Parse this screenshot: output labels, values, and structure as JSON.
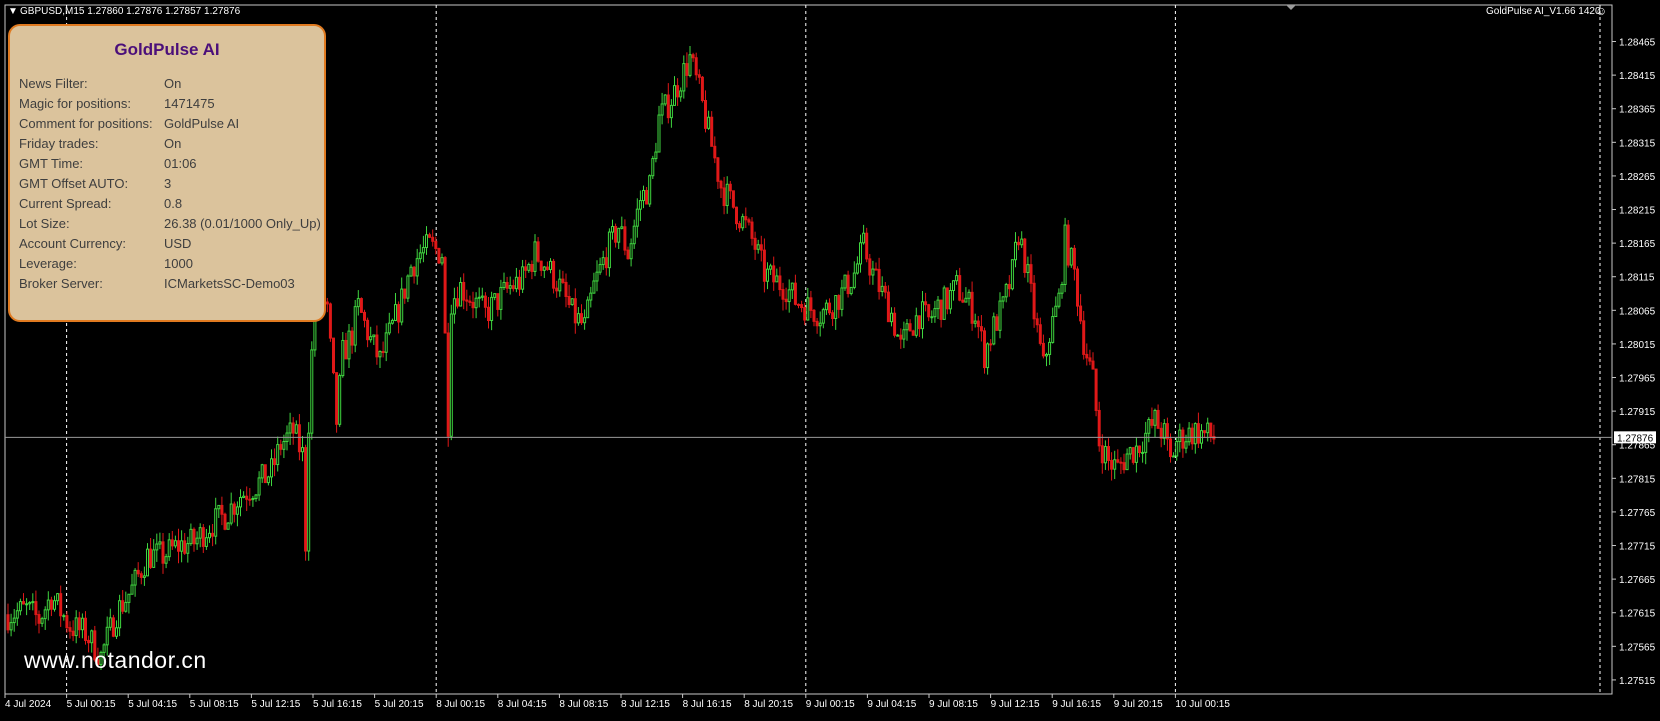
{
  "header": {
    "symbol_info": "GBPUSD,M15  1.27860 1.27876 1.27857 1.27876",
    "ea_label": "GoldPulse AI_V1.66 1420"
  },
  "panel": {
    "title": "GoldPulse AI",
    "rows": [
      {
        "label": "News Filter:",
        "value": "On"
      },
      {
        "label": "Magic for positions:",
        "value": "1471475"
      },
      {
        "label": "Comment for positions:",
        "value": "GoldPulse AI"
      },
      {
        "label": "Friday trades:",
        "value": "On"
      },
      {
        "label": "GMT Time:",
        "value": "01:06"
      },
      {
        "label": "GMT Offset AUTO:",
        "value": "3"
      },
      {
        "label": "Current Spread:",
        "value": "0.8"
      },
      {
        "label": "Lot Size:",
        "value": "26.38 (0.01/1000 Only_Up)"
      },
      {
        "label": "Account Currency:",
        "value": "USD"
      },
      {
        "label": "Leverage:",
        "value": "1000"
      },
      {
        "label": "Broker Server:",
        "value": "ICMarketsSC-Demo03"
      }
    ]
  },
  "watermark": "www.notandor.cn",
  "colors": {
    "background": "#000000",
    "bull": "#3fd63f",
    "bear": "#e01818",
    "grid": "#ffffff",
    "panel_bg": "#dbc39c",
    "panel_border": "#e07a20",
    "panel_title": "#4b0f7a"
  },
  "chart_data": {
    "type": "candlestick",
    "symbol": "GBPUSD",
    "timeframe": "M15",
    "current_price": "1.27876",
    "y_ticks": [
      "1.28465",
      "1.28415",
      "1.28365",
      "1.28315",
      "1.28265",
      "1.28215",
      "1.28165",
      "1.28115",
      "1.28065",
      "1.28015",
      "1.27965",
      "1.27915",
      "1.27865",
      "1.27815",
      "1.27765",
      "1.27715",
      "1.27665",
      "1.27615",
      "1.27565",
      "1.27515"
    ],
    "x_ticks": [
      "4 Jul 2024",
      "5 Jul 00:15",
      "5 Jul 04:15",
      "5 Jul 08:15",
      "5 Jul 12:15",
      "5 Jul 16:15",
      "5 Jul 20:15",
      "8 Jul 00:15",
      "8 Jul 04:15",
      "8 Jul 08:15",
      "8 Jul 12:15",
      "8 Jul 16:15",
      "8 Jul 20:15",
      "9 Jul 00:15",
      "9 Jul 04:15",
      "9 Jul 08:15",
      "9 Jul 12:15",
      "9 Jul 16:15",
      "9 Jul 20:15",
      "10 Jul 00:15"
    ],
    "day_separators": [
      "5 Jul 00:15",
      "8 Jul 00:15",
      "9 Jul 00:15",
      "10 Jul 00:15"
    ],
    "ylim": [
      1.275,
      1.285
    ],
    "close_path": [
      [
        0,
        1.27612
      ],
      [
        6,
        1.2762
      ],
      [
        10,
        1.27605
      ],
      [
        14,
        1.2764
      ],
      [
        20,
        1.27595
      ],
      [
        25,
        1.27585
      ],
      [
        30,
        1.2755
      ],
      [
        35,
        1.27615
      ],
      [
        40,
        1.2765
      ],
      [
        45,
        1.277
      ],
      [
        50,
        1.277
      ],
      [
        55,
        1.27715
      ],
      [
        60,
        1.2772
      ],
      [
        65,
        1.27745
      ],
      [
        70,
        1.2776
      ],
      [
        75,
        1.2779
      ],
      [
        80,
        1.27805
      ],
      [
        85,
        1.27825
      ],
      [
        88,
        1.27865
      ],
      [
        92,
        1.27885
      ],
      [
        95,
        1.2785
      ],
      [
        96,
        1.2772
      ],
      [
        97,
        1.279
      ],
      [
        98,
        1.28
      ],
      [
        99,
        1.2808
      ],
      [
        100,
        1.281
      ],
      [
        103,
        1.2806
      ],
      [
        106,
        1.279
      ],
      [
        108,
        1.28
      ],
      [
        111,
        1.2803
      ],
      [
        113,
        1.2807
      ],
      [
        117,
        1.2802
      ],
      [
        120,
        1.2799
      ],
      [
        124,
        1.2804
      ],
      [
        127,
        1.2808
      ],
      [
        130,
        1.2813
      ],
      [
        133,
        1.2815
      ],
      [
        136,
        1.2816
      ],
      [
        140,
        1.2815
      ],
      [
        142,
        1.279
      ],
      [
        143,
        1.2808
      ],
      [
        146,
        1.281
      ],
      [
        150,
        1.2808
      ],
      [
        154,
        1.2806
      ],
      [
        158,
        1.2808
      ],
      [
        162,
        1.281
      ],
      [
        166,
        1.2811
      ],
      [
        170,
        1.2815
      ],
      [
        174,
        1.2813
      ],
      [
        178,
        1.281
      ],
      [
        182,
        1.2806
      ],
      [
        186,
        1.2804
      ],
      [
        189,
        1.281
      ],
      [
        193,
        1.2815
      ],
      [
        197,
        1.2819
      ],
      [
        200,
        1.2815
      ],
      [
        204,
        1.2823
      ],
      [
        207,
        1.2825
      ],
      [
        210,
        1.2835
      ],
      [
        214,
        1.2838
      ],
      [
        218,
        1.2842
      ],
      [
        220,
        1.2844
      ],
      [
        223,
        1.2839
      ],
      [
        226,
        1.2833
      ],
      [
        230,
        1.2825
      ],
      [
        234,
        1.2822
      ],
      [
        238,
        1.2819
      ],
      [
        241,
        1.2816
      ],
      [
        244,
        1.2812
      ],
      [
        247,
        1.2811
      ],
      [
        251,
        1.281
      ],
      [
        254,
        1.2808
      ],
      [
        258,
        1.2807
      ],
      [
        262,
        1.2806
      ],
      [
        265,
        1.2807
      ],
      [
        269,
        1.2809
      ],
      [
        273,
        1.2812
      ],
      [
        276,
        1.2816
      ],
      [
        279,
        1.2812
      ],
      [
        282,
        1.2809
      ],
      [
        285,
        1.2806
      ],
      [
        288,
        1.2801
      ],
      [
        291,
        1.2804
      ],
      [
        294,
        1.2806
      ],
      [
        297,
        1.2805
      ],
      [
        300,
        1.2807
      ],
      [
        303,
        1.2808
      ],
      [
        306,
        1.281
      ],
      [
        309,
        1.2808
      ],
      [
        312,
        1.2806
      ],
      [
        315,
        1.28
      ],
      [
        318,
        1.2804
      ],
      [
        321,
        1.2807
      ],
      [
        324,
        1.2812
      ],
      [
        326,
        1.2818
      ],
      [
        328,
        1.2814
      ],
      [
        331,
        1.2806
      ],
      [
        334,
        1.2798
      ],
      [
        336,
        1.2803
      ],
      [
        339,
        1.2808
      ],
      [
        341,
        1.2817
      ],
      [
        344,
        1.2812
      ],
      [
        347,
        1.2802
      ],
      [
        350,
        1.2796
      ],
      [
        352,
        1.2787
      ],
      [
        355,
        1.2784
      ],
      [
        358,
        1.2783
      ],
      [
        361,
        1.2785
      ],
      [
        364,
        1.2786
      ],
      [
        367,
        1.2788
      ],
      [
        370,
        1.279
      ],
      [
        373,
        1.2788
      ],
      [
        375,
        1.2784
      ],
      [
        377,
        1.2787
      ],
      [
        380,
        1.2788
      ],
      [
        383,
        1.27885
      ],
      [
        386,
        1.2788
      ],
      [
        389,
        1.27876
      ]
    ]
  }
}
